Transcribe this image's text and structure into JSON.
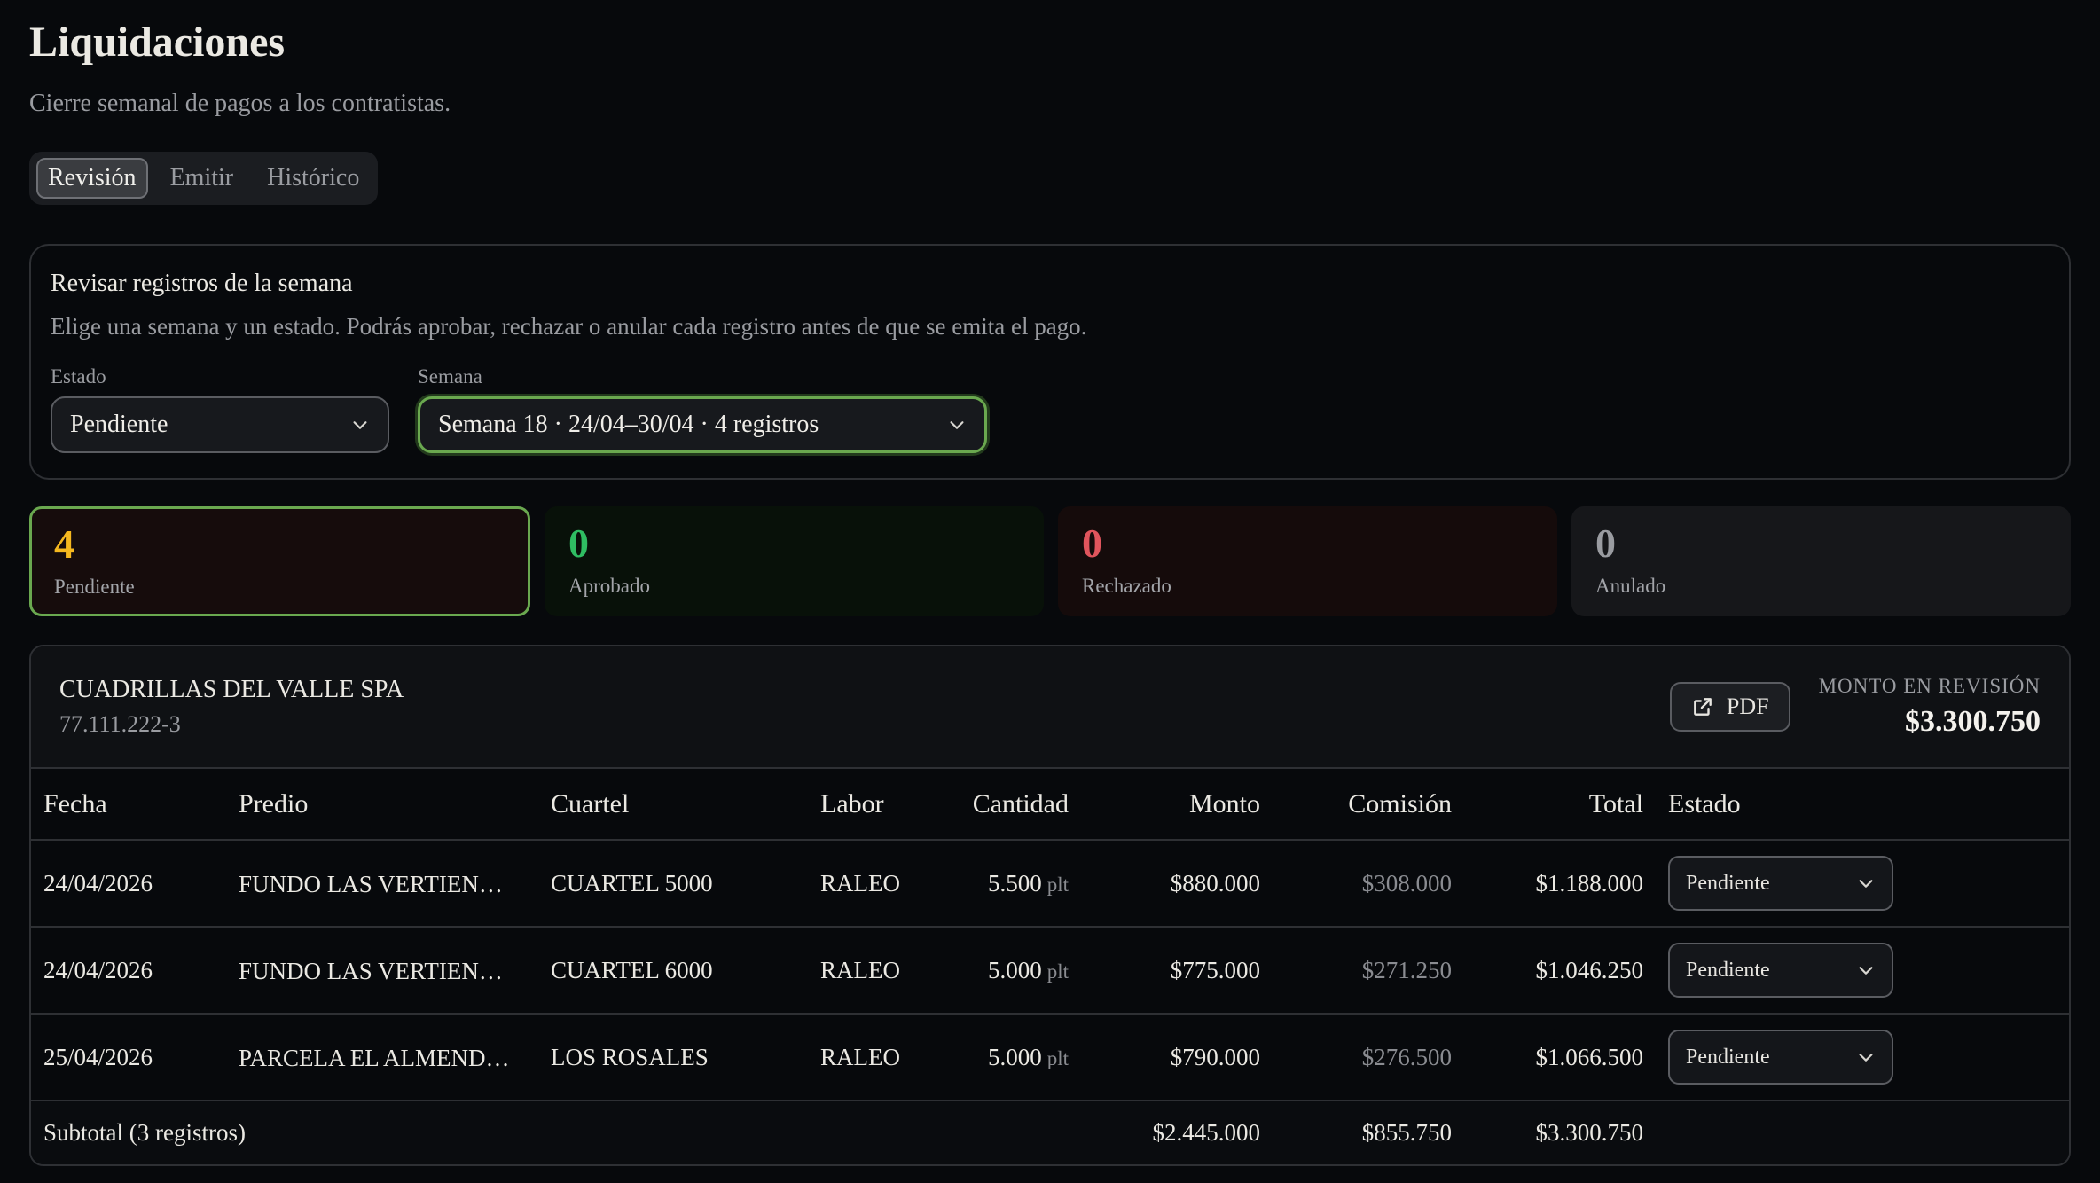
{
  "header": {
    "title": "Liquidaciones",
    "subtitle": "Cierre semanal de pagos a los contratistas."
  },
  "tabs": [
    {
      "label": "Revisión",
      "active": true
    },
    {
      "label": "Emitir",
      "active": false
    },
    {
      "label": "Histórico",
      "active": false
    }
  ],
  "review": {
    "title": "Revisar registros de la semana",
    "description": "Elige una semana y un estado. Podrás aprobar, rechazar o anular cada registro antes de que se emita el pago.",
    "estado_label": "Estado",
    "estado_value": "Pendiente",
    "semana_label": "Semana",
    "semana_value": "Semana 18 · 24/04–30/04 · 4 registros"
  },
  "stats": [
    {
      "value": "4",
      "label": "Pendiente",
      "color": "#f5b81f"
    },
    {
      "value": "0",
      "label": "Aprobado",
      "color": "#2fbd62"
    },
    {
      "value": "0",
      "label": "Rechazado",
      "color": "#e0555d"
    },
    {
      "value": "0",
      "label": "Anulado",
      "color": "#9a9ca1"
    }
  ],
  "contractor": {
    "name": "CUADRILLAS DEL VALLE SPA",
    "rut": "77.111.222-3",
    "pdf_label": "PDF",
    "amount_label": "MONTO EN REVISIÓN",
    "amount_value": "$3.300.750"
  },
  "table": {
    "headers": [
      "Fecha",
      "Predio",
      "Cuartel",
      "Labor",
      "Cantidad",
      "Monto",
      "Comisión",
      "Total",
      "Estado"
    ],
    "rows": [
      {
        "fecha": "24/04/2026",
        "predio": "FUNDO LAS VERTIEN…",
        "cuartel": "CUARTEL 5000",
        "labor": "RALEO",
        "cantidad": "5.500",
        "unidad": "plt",
        "monto": "$880.000",
        "comision": "$308.000",
        "total": "$1.188.000",
        "estado": "Pendiente"
      },
      {
        "fecha": "24/04/2026",
        "predio": "FUNDO LAS VERTIEN…",
        "cuartel": "CUARTEL 6000",
        "labor": "RALEO",
        "cantidad": "5.000",
        "unidad": "plt",
        "monto": "$775.000",
        "comision": "$271.250",
        "total": "$1.046.250",
        "estado": "Pendiente"
      },
      {
        "fecha": "25/04/2026",
        "predio": "PARCELA EL ALMEND…",
        "cuartel": "LOS ROSALES",
        "labor": "RALEO",
        "cantidad": "5.000",
        "unidad": "plt",
        "monto": "$790.000",
        "comision": "$276.500",
        "total": "$1.066.500",
        "estado": "Pendiente"
      }
    ],
    "subtotal": {
      "label": "Subtotal (3 registros)",
      "monto": "$2.445.000",
      "comision": "$855.750",
      "total": "$3.300.750"
    }
  }
}
